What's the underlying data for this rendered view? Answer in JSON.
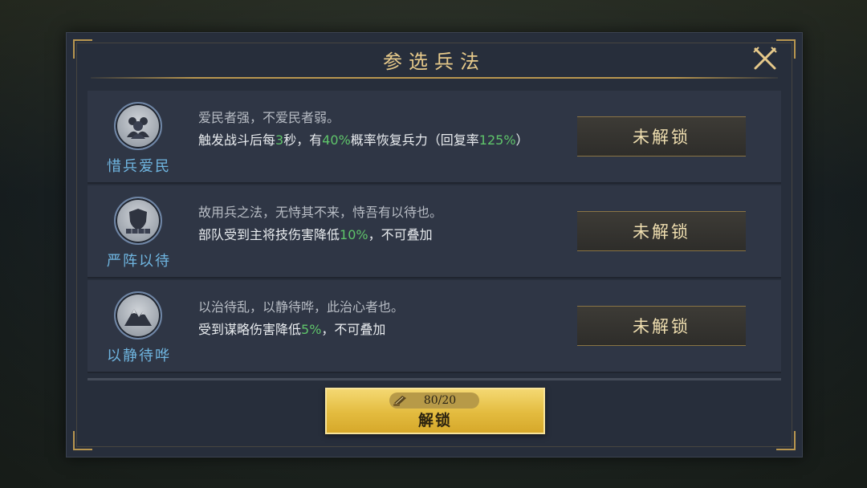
{
  "dialog": {
    "title": "参选兵法",
    "close_icon": "crossed-swords-close-icon"
  },
  "skills": [
    {
      "name": "惜兵爱民",
      "icon": "soldiers-group-icon",
      "line1": "爱民者强，不爱民者弱。",
      "line2_parts": [
        "触发战斗后每",
        "3",
        "秒，有",
        "40%",
        "概率恢复兵力（回复率",
        "125%",
        "）"
      ],
      "button": "未解锁"
    },
    {
      "name": "严阵以待",
      "icon": "shield-wall-icon",
      "line1": "故用兵之法，无恃其不来，恃吾有以待也。",
      "line2_parts": [
        "部队受到主将技伤害降低",
        "10%",
        "，不可叠加"
      ],
      "button": "未解锁"
    },
    {
      "name": "以静待哗",
      "icon": "mountain-icon",
      "line1": "以治待乱，以静待哗，此治心者也。",
      "line2_parts": [
        "受到谋略伤害降低",
        "5%",
        "，不可叠加"
      ],
      "button": "未解锁"
    }
  ],
  "unlock": {
    "cost": "80/20",
    "cost_icon": "scroll-book-icon",
    "label": "解锁"
  },
  "colors": {
    "highlight_green": "#5fc46a",
    "title_gold": "#e6c98a",
    "skill_name_blue": "#6fb5e0",
    "unlock_gold": "#e3bb3f"
  }
}
